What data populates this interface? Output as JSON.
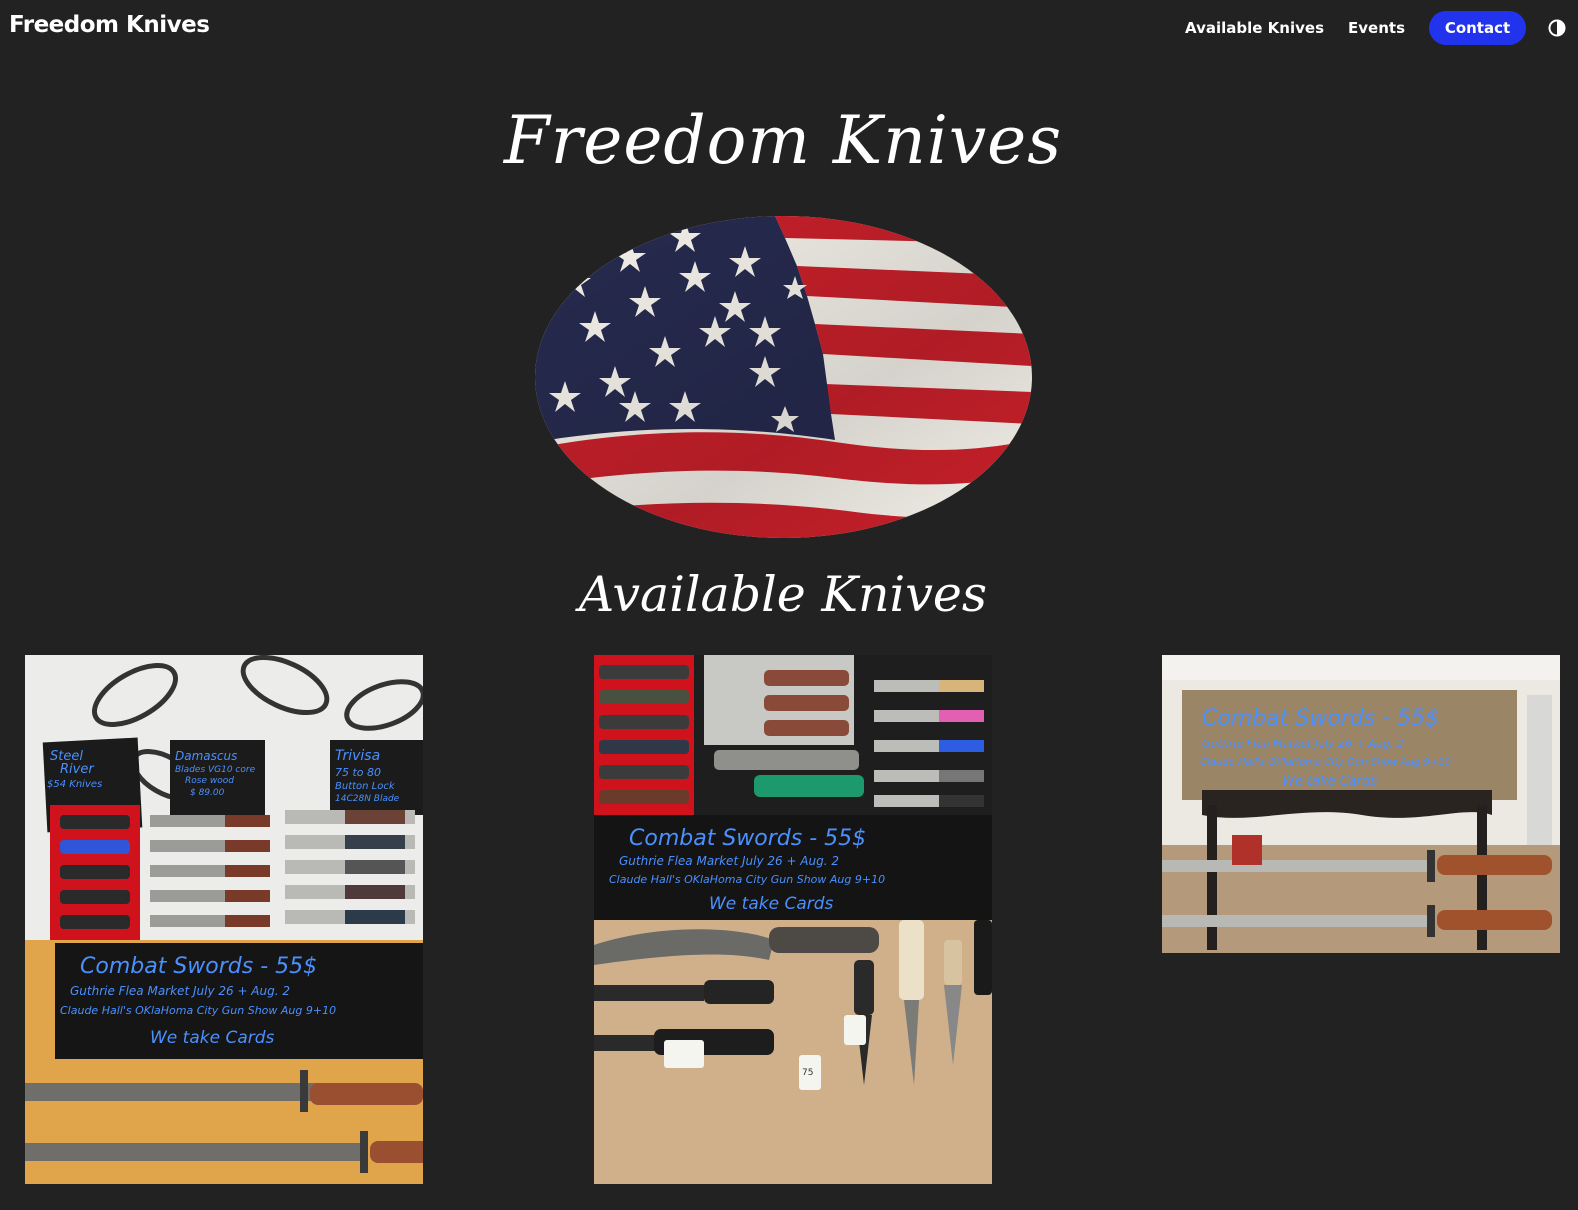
{
  "header": {
    "brand": "Freedom Knives",
    "nav": [
      {
        "label": "Available Knives"
      },
      {
        "label": "Events"
      }
    ],
    "contact_label": "Contact",
    "theme_icon": "half-circle-contrast-icon"
  },
  "hero": {
    "title": "Freedom Knives",
    "image": "american-flag-oval"
  },
  "section": {
    "title": "Available Knives"
  },
  "gallery": [
    {
      "image": "knife-display-table-1",
      "signs": {
        "steel_river": [
          "Steel",
          "River",
          "$54 Knives"
        ],
        "damascus": [
          "Damascus",
          "Blades VG10 core",
          "Rose wood",
          "$ 89.00"
        ],
        "trivisa": [
          "Trivisa",
          "75 to 80",
          "Button Lock",
          "14C28N Blade"
        ]
      },
      "banner": {
        "line1": "Combat   Swords - 55$",
        "line2": "Guthrie Flea Market   July 26 + Aug. 2",
        "line3": "Claude Hall's OKlaHoma City Gun Show Aug 9+10",
        "line4": "We take Cards"
      }
    },
    {
      "image": "knife-display-table-2",
      "banner": {
        "line1": "Combat   Swords - 55$",
        "line2": "Guthrie Flea Market   July 26 + Aug. 2",
        "line3": "Claude Hall's OKlaHoma City Gun Show Aug 9+10",
        "line4": "We take Cards"
      },
      "price_tag": "75"
    },
    {
      "image": "combat-swords-rack",
      "banner": {
        "line1": "Combat   Swords - 55$",
        "line2": "Guthrie Flea Market   July 26 + Aug. 2",
        "line3": "Claude Hall's OKlaHoma City Gun Show Aug 9+10",
        "line4": "We take Cards"
      }
    }
  ],
  "colors": {
    "background": "#222222",
    "accent": "#2233ee",
    "text": "#ffffff",
    "flag_red": "#c8202a",
    "flag_blue": "#262a4e",
    "chalk_blue": "#5aa0ff"
  }
}
